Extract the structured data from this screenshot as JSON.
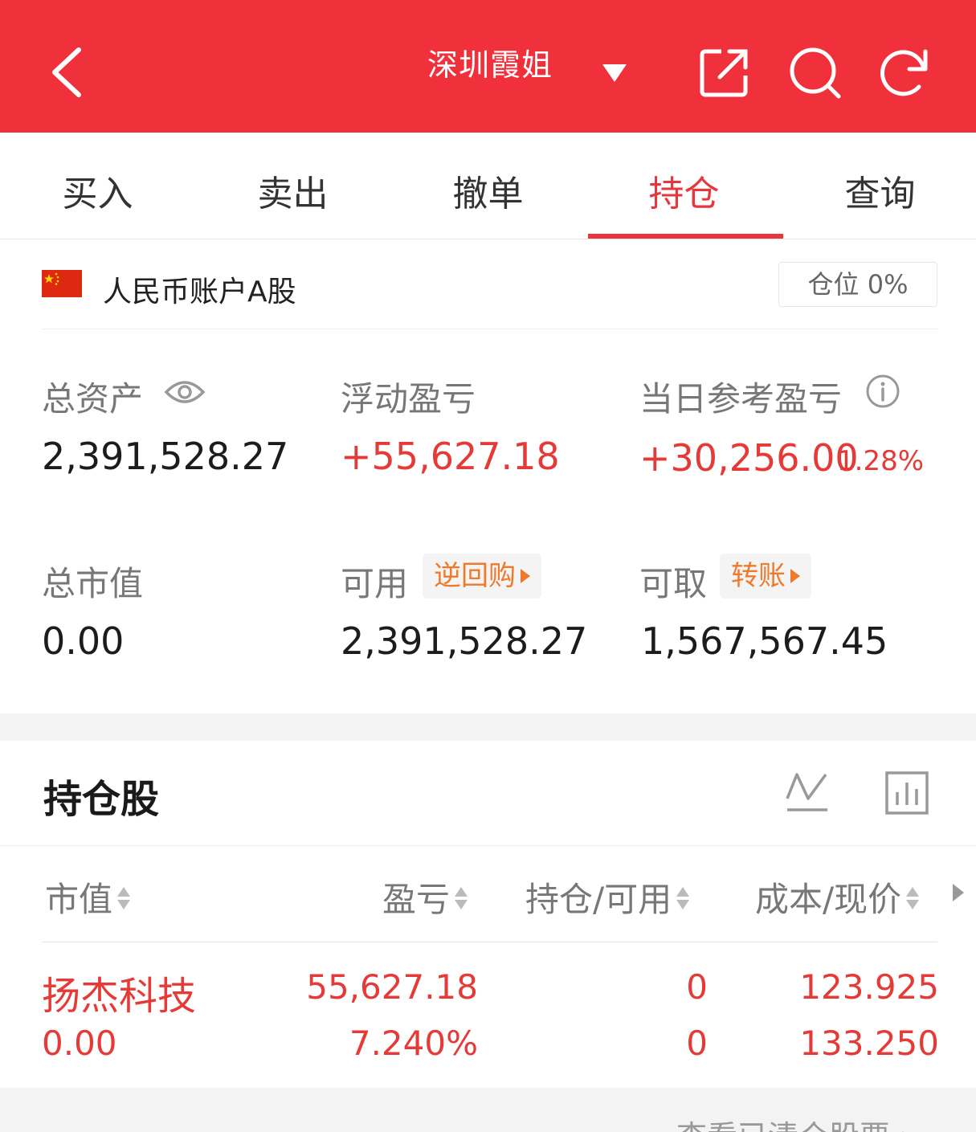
{
  "header": {
    "title": "深圳霞姐",
    "icons": [
      "back-arrow-icon",
      "dropdown-caret-icon",
      "share-external-icon",
      "search-icon",
      "refresh-icon"
    ],
    "bg_color": "#f0303a"
  },
  "tabs": [
    {
      "label": "买入",
      "active": false
    },
    {
      "label": "卖出",
      "active": false
    },
    {
      "label": "撤单",
      "active": false
    },
    {
      "label": "持仓",
      "active": true
    },
    {
      "label": "查询",
      "active": false
    }
  ],
  "account": {
    "flag_icon": "china-flag-icon",
    "name": "人民币账户A股",
    "position_label": "仓位",
    "position_value": "0%"
  },
  "summary": {
    "total_assets": {
      "label": "总资产",
      "value": "2,391,528.27",
      "icon": "eye-icon"
    },
    "floating_pnl": {
      "label": "浮动盈亏",
      "value": "+55,627.18"
    },
    "daily_pnl": {
      "label": "当日参考盈亏",
      "value": "+30,256.00",
      "pct": "1.28%",
      "icon": "info-icon"
    },
    "market_value": {
      "label": "总市值",
      "value": "0.00"
    },
    "available": {
      "label": "可用",
      "value": "2,391,528.27",
      "action": "逆回购"
    },
    "withdrawable": {
      "label": "可取",
      "value": "1,567,567.45",
      "action": "转账"
    }
  },
  "holdings": {
    "title": "持仓股",
    "icons": [
      "line-chart-icon",
      "bar-chart-icon"
    ],
    "columns": [
      "市值",
      "盈亏",
      "持仓/可用",
      "成本/现价"
    ],
    "rows": [
      {
        "name": "扬杰科技",
        "market_value": "0.00",
        "pnl": "55,627.18",
        "pnl_pct": "7.240%",
        "position": "0",
        "available": "0",
        "cost": "123.925",
        "price": "133.250"
      }
    ],
    "footer_link": "查看已清仓股票"
  }
}
